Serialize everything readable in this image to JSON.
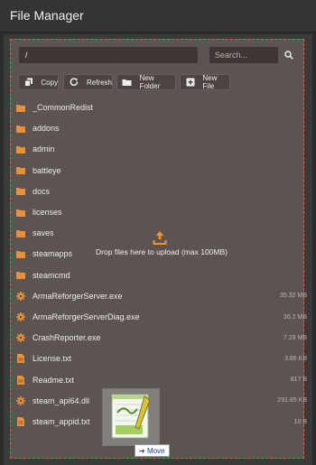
{
  "header": {
    "title": "File Manager"
  },
  "path": {
    "value": "/"
  },
  "search": {
    "placeholder": "Search..."
  },
  "toolbar": {
    "copy": "Copy",
    "refresh": "Refresh",
    "new_folder": "New Folder",
    "new_file": "New File"
  },
  "drop": {
    "text": "Drop files here to upload (max 100MB)"
  },
  "files": [
    {
      "name": "_CommonRedist",
      "type": "folder",
      "size": ""
    },
    {
      "name": "addons",
      "type": "folder",
      "size": ""
    },
    {
      "name": "admin",
      "type": "folder",
      "size": ""
    },
    {
      "name": "battleye",
      "type": "folder",
      "size": ""
    },
    {
      "name": "docs",
      "type": "folder",
      "size": ""
    },
    {
      "name": "licenses",
      "type": "folder",
      "size": ""
    },
    {
      "name": "saves",
      "type": "folder",
      "size": ""
    },
    {
      "name": "steamapps",
      "type": "folder",
      "size": ""
    },
    {
      "name": "steamcmd",
      "type": "folder",
      "size": ""
    },
    {
      "name": "ArmaReforgerServer.exe",
      "type": "exe",
      "size": "35.32 MB"
    },
    {
      "name": "ArmaReforgerServerDiag.exe",
      "type": "exe",
      "size": "36.2 MB"
    },
    {
      "name": "CrashReporter.exe",
      "type": "exe",
      "size": "7.29 MB"
    },
    {
      "name": "License.txt",
      "type": "txt",
      "size": "3.86 KB"
    },
    {
      "name": "Readme.txt",
      "type": "txt",
      "size": "817 B"
    },
    {
      "name": "steam_api64.dll",
      "type": "exe",
      "size": "291.85 KB"
    },
    {
      "name": "steam_appid.txt",
      "type": "txt",
      "size": "10 B"
    }
  ],
  "drag": {
    "tooltip": "Move"
  },
  "colors": {
    "accent": "#e8913a",
    "border": "#e05a3c",
    "zone": "#5c5451"
  }
}
